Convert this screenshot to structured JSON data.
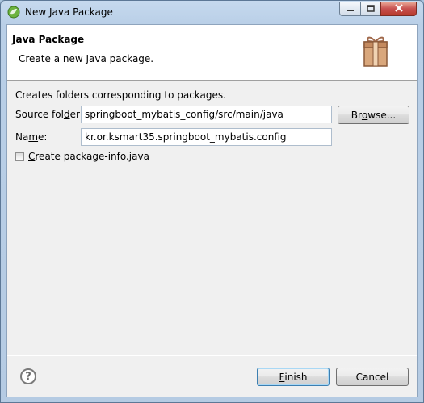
{
  "window": {
    "title": "New Java Package",
    "icons": {
      "app": "eclipse-spring-icon",
      "minimize": "minimize-icon",
      "maximize": "maximize-icon",
      "close": "close-icon"
    }
  },
  "banner": {
    "title": "Java Package",
    "description": "Create a new Java package.",
    "icon": "package-gift-icon"
  },
  "form": {
    "info": "Creates folders corresponding to packages.",
    "source_folder": {
      "label_pre": "Source fol",
      "label_mnemonic": "d",
      "label_post": "er:",
      "value": "springboot_mybatis_config/src/main/java"
    },
    "name": {
      "label_pre": "Na",
      "label_mnemonic": "m",
      "label_post": "e:",
      "value": "kr.or.ksmart35.springboot_mybatis.config"
    },
    "browse": {
      "label_pre": "Br",
      "label_mnemonic": "o",
      "label_post": "wse..."
    },
    "package_info": {
      "label_mnemonic": "C",
      "label_post": "reate package-info.java",
      "checked": false
    }
  },
  "footer": {
    "help_icon": "question-mark-icon",
    "help_glyph": "?",
    "finish": {
      "label_mnemonic": "F",
      "label_post": "inish"
    },
    "cancel": {
      "label": "Cancel"
    }
  },
  "colors": {
    "title_bar": "#c6d9ee",
    "dialog_bg": "#f0f0f0",
    "close_button": "#c75050",
    "default_button_border": "#3c7fb1"
  }
}
